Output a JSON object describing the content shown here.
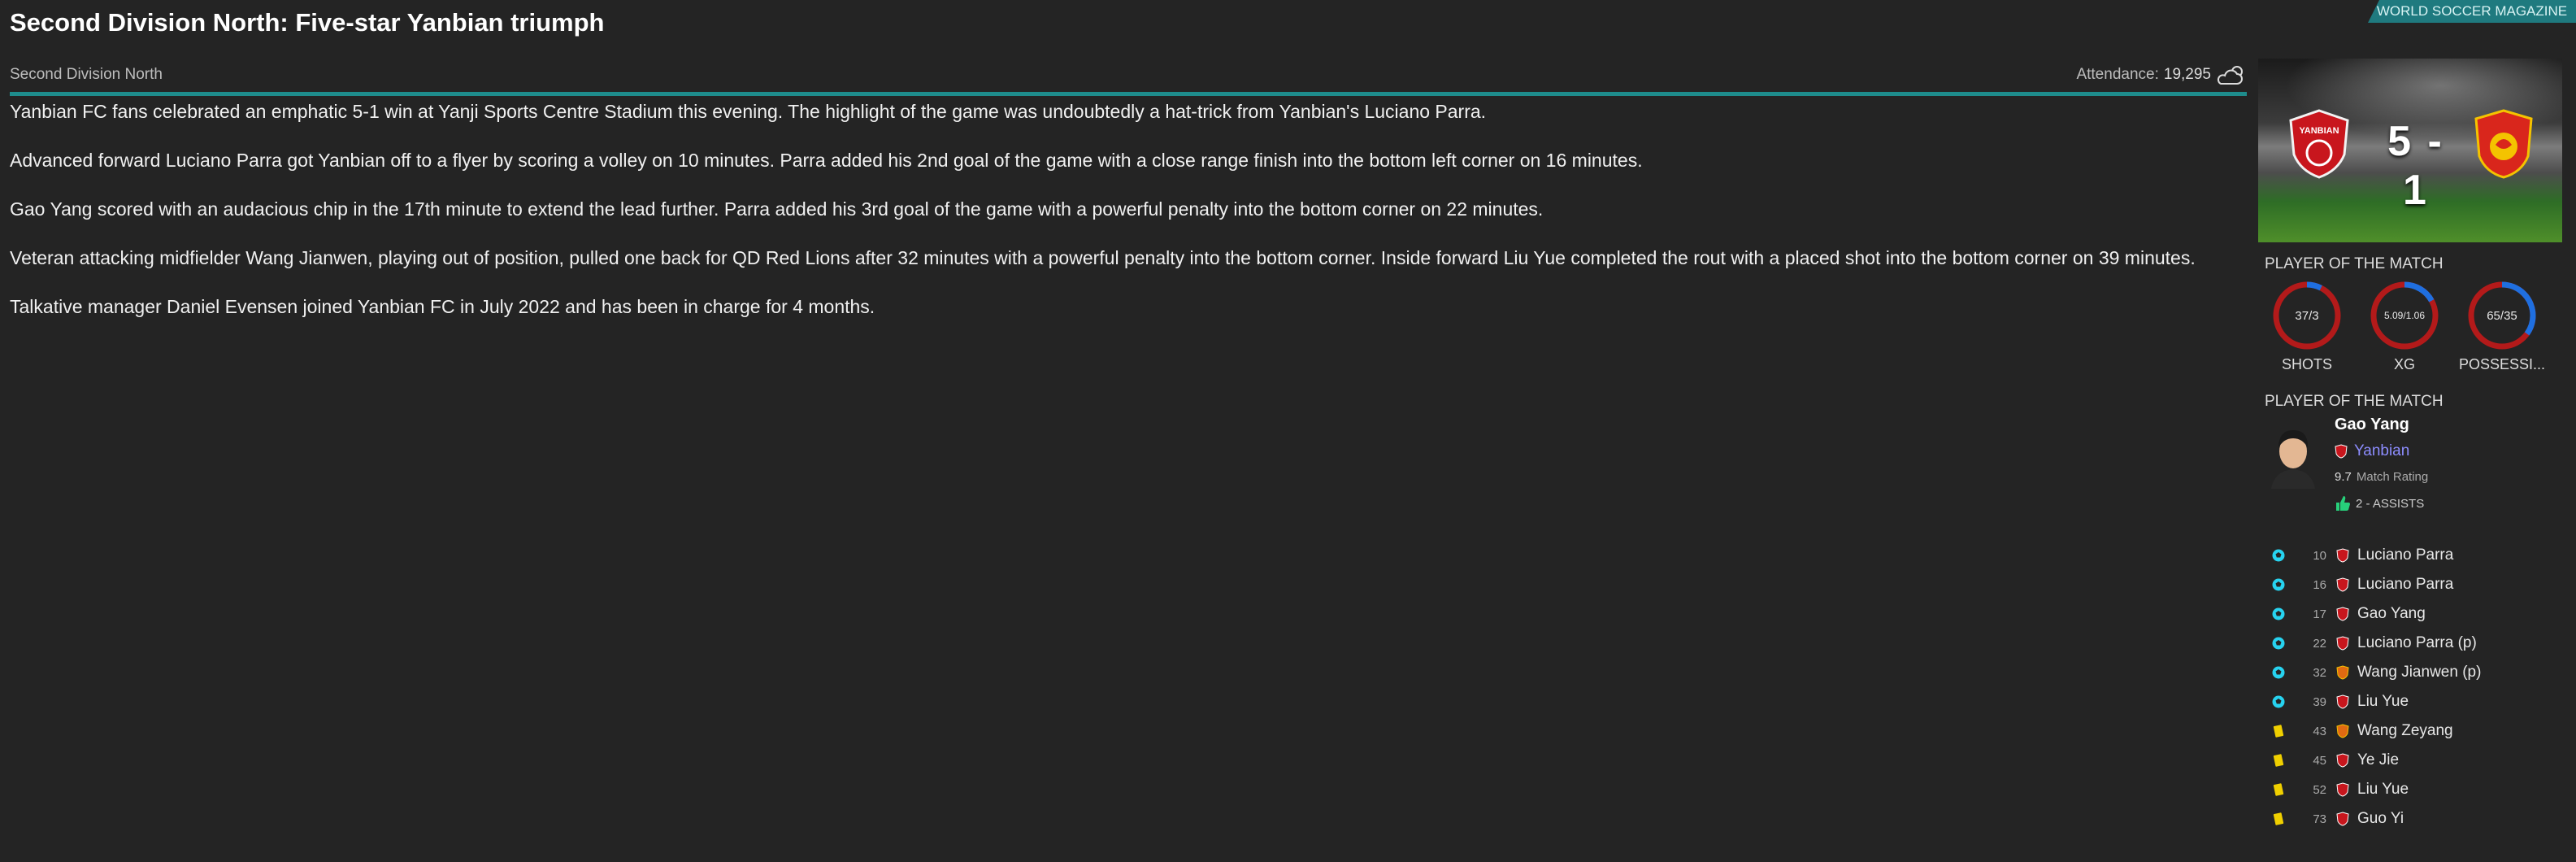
{
  "headline": "Second Division North: Five-star Yanbian triumph",
  "source": "WORLD SOCCER MAGAZINE",
  "competition": "Second Division North",
  "attendance_label": "Attendance:",
  "attendance_value": "19,295",
  "article": [
    "Yanbian FC fans celebrated an emphatic 5-1 win at Yanji Sports Centre Stadium this evening. The highlight of the game was undoubtedly a hat-trick from Yanbian's Luciano Parra.",
    "Advanced forward Luciano Parra got Yanbian off to a flyer by scoring a volley on 10 minutes. Parra added his 2nd goal of the game with a close range finish into the bottom left corner on 16 minutes.",
    "Gao Yang scored with an audacious chip in the 17th minute to extend the lead further. Parra added his 3rd goal of the game with a powerful penalty into the bottom corner on 22 minutes.",
    "Veteran attacking midfielder Wang Jianwen, playing out of position, pulled one back for QD Red Lions after 32 minutes with a powerful penalty into the bottom corner. Inside forward Liu Yue completed the rout with a placed shot into the bottom corner on 39 minutes.",
    "Talkative manager Daniel Evensen joined Yanbian FC in July 2022 and has been in charge for 4 months."
  ],
  "score": {
    "text": "5 - 1",
    "home_crest_text": "YANBIAN"
  },
  "stats_title": "PLAYER OF THE MATCH",
  "stats": [
    {
      "label": "SHOTS",
      "value": "37/3",
      "home_share": 0.925
    },
    {
      "label": "XG",
      "value": "5.09/1.06",
      "home_share": 0.83
    },
    {
      "label": "POSSESSI...",
      "value": "65/35",
      "home_share": 0.65
    }
  ],
  "potm_title": "PLAYER OF THE MATCH",
  "potm": {
    "name": "Gao Yang",
    "team": "Yanbian",
    "rating": "9.7",
    "rating_label": "Match Rating",
    "assists": "2 - ASSISTS"
  },
  "colors": {
    "accent": "#1e8c8c",
    "home_red": "#b31a1a",
    "away_blue": "#1f6fe0",
    "goal_cyan": "#27d3f0",
    "card_yellow": "#f0d000"
  },
  "events": [
    {
      "type": "goal",
      "minute": "10",
      "team": "home",
      "player": "Luciano Parra"
    },
    {
      "type": "goal",
      "minute": "16",
      "team": "home",
      "player": "Luciano Parra"
    },
    {
      "type": "goal",
      "minute": "17",
      "team": "home",
      "player": "Gao Yang"
    },
    {
      "type": "goal",
      "minute": "22",
      "team": "home",
      "player": "Luciano Parra (p)"
    },
    {
      "type": "goal",
      "minute": "32",
      "team": "away",
      "player": "Wang Jianwen (p)"
    },
    {
      "type": "goal",
      "minute": "39",
      "team": "home",
      "player": "Liu Yue"
    },
    {
      "type": "yellow-card",
      "minute": "43",
      "team": "away",
      "player": "Wang Zeyang"
    },
    {
      "type": "yellow-card",
      "minute": "45",
      "team": "home",
      "player": "Ye Jie"
    },
    {
      "type": "yellow-card",
      "minute": "52",
      "team": "home",
      "player": "Liu Yue"
    },
    {
      "type": "yellow-card",
      "minute": "73",
      "team": "home",
      "player": "Guo Yi"
    }
  ]
}
